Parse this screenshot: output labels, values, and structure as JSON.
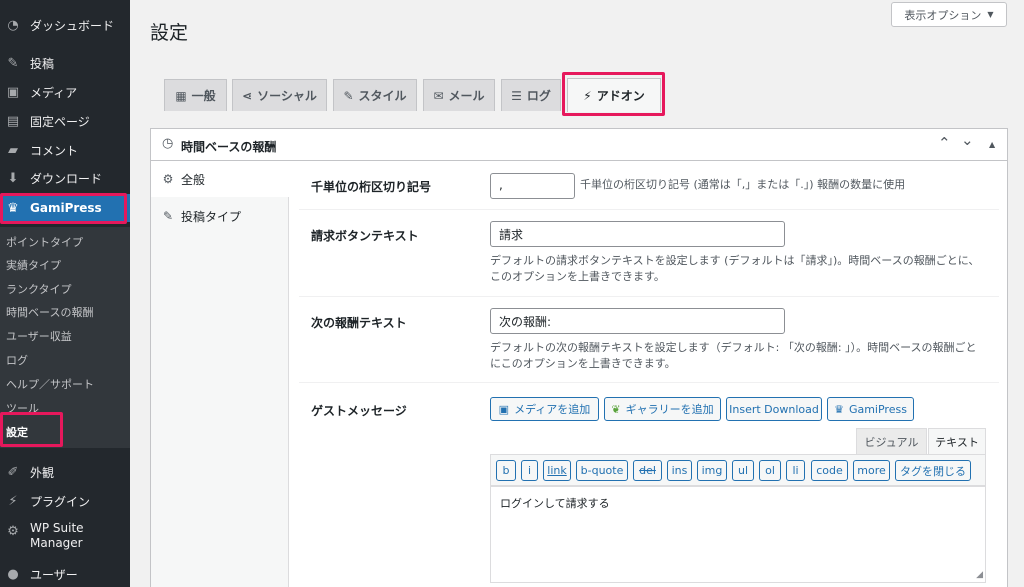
{
  "sidebar": {
    "items": [
      {
        "label": "ダッシュボード",
        "icon": "dashboard-icon",
        "glyph": "◔"
      },
      {
        "label": "投稿",
        "icon": "pin-icon",
        "glyph": "✎"
      },
      {
        "label": "メディア",
        "icon": "media-icon",
        "glyph": "▣"
      },
      {
        "label": "固定ページ",
        "icon": "page-icon",
        "glyph": "▤"
      },
      {
        "label": "コメント",
        "icon": "comment-icon",
        "glyph": "▰"
      },
      {
        "label": "ダウンロード",
        "icon": "download-icon",
        "glyph": "⬇"
      },
      {
        "label": "GamiPress",
        "icon": "crown-icon",
        "glyph": "♛"
      },
      {
        "label": "外観",
        "icon": "appearance-icon",
        "glyph": "✐"
      },
      {
        "label": "プラグイン",
        "icon": "plugin-icon",
        "glyph": "⚡"
      },
      {
        "label": "WP Suite Manager",
        "icon": "gear-icon",
        "glyph": "⚙"
      },
      {
        "label": "ユーザー",
        "icon": "user-icon",
        "glyph": "●"
      }
    ],
    "submenu": [
      "ポイントタイプ",
      "実績タイプ",
      "ランクタイプ",
      "時間ベースの報酬",
      "ユーザー収益",
      "ログ",
      "ヘルプ／サポート",
      "ツール",
      "設定"
    ]
  },
  "page": {
    "title": "設定",
    "screen_options": "表示オプション",
    "screen_options_arrow": "▼"
  },
  "tabs": [
    {
      "label": "一般",
      "icon": "general-icon",
      "glyph": "▦"
    },
    {
      "label": "ソーシャル",
      "icon": "share-icon",
      "glyph": "⋖"
    },
    {
      "label": "スタイル",
      "icon": "brush-icon",
      "glyph": "✎"
    },
    {
      "label": "メール",
      "icon": "mail-icon",
      "glyph": "✉"
    },
    {
      "label": "ログ",
      "icon": "list-icon",
      "glyph": "☰"
    },
    {
      "label": "アドオン",
      "icon": "plugin-icon",
      "glyph": "⚡"
    }
  ],
  "box": {
    "title": "時間ベースの報酬",
    "clock_glyph": "◷",
    "up_glyph": "⌃",
    "down_glyph": "⌄",
    "toggle_glyph": "▲",
    "vtabs": [
      {
        "label": "全般",
        "icon": "gear-icon",
        "glyph": "⚙"
      },
      {
        "label": "投稿タイプ",
        "icon": "pin-icon",
        "glyph": "✎"
      }
    ]
  },
  "settings": {
    "thousands_sep": {
      "label": "千単位の桁区切り記号",
      "value": ",",
      "desc": "千単位の桁区切り記号 (通常は「,」または「.」) 報酬の数量に使用"
    },
    "claim_button": {
      "label": "請求ボタンテキスト",
      "value": "請求",
      "desc1": "デフォルトの請求ボタンテキストを設定します (デフォルトは「請求」)。時間ベースの報酬ごとに、",
      "desc2": "このオプションを上書きできます。"
    },
    "next_reward": {
      "label": "次の報酬テキスト",
      "value": "次の報酬:",
      "desc1": "デフォルトの次の報酬テキストを設定します（デフォルト: 「次の報酬: 」）。時間ベースの報酬ごと",
      "desc2": "にこのオプションを上書きできます。"
    },
    "guest_message": {
      "label": "ゲストメッセージ",
      "media_buttons": [
        {
          "label": "メディアを追加",
          "glyph": "▣"
        },
        {
          "label": "ギャラリーを追加",
          "glyph": "❦"
        },
        {
          "label": "Insert Download",
          "glyph": ""
        },
        {
          "label": "GamiPress",
          "glyph": "♛"
        }
      ],
      "editor_tabs": [
        "ビジュアル",
        "テキスト"
      ],
      "quicktags": [
        "b",
        "i",
        "link",
        "b-quote",
        "del",
        "ins",
        "img",
        "ul",
        "ol",
        "li",
        "code",
        "more",
        "タグを閉じる"
      ],
      "content": "ログインして請求する"
    }
  },
  "colors": {
    "sidebar_bg": "#23282d",
    "active_blue": "#2271b1",
    "highlight_pink": "#e6185c"
  }
}
